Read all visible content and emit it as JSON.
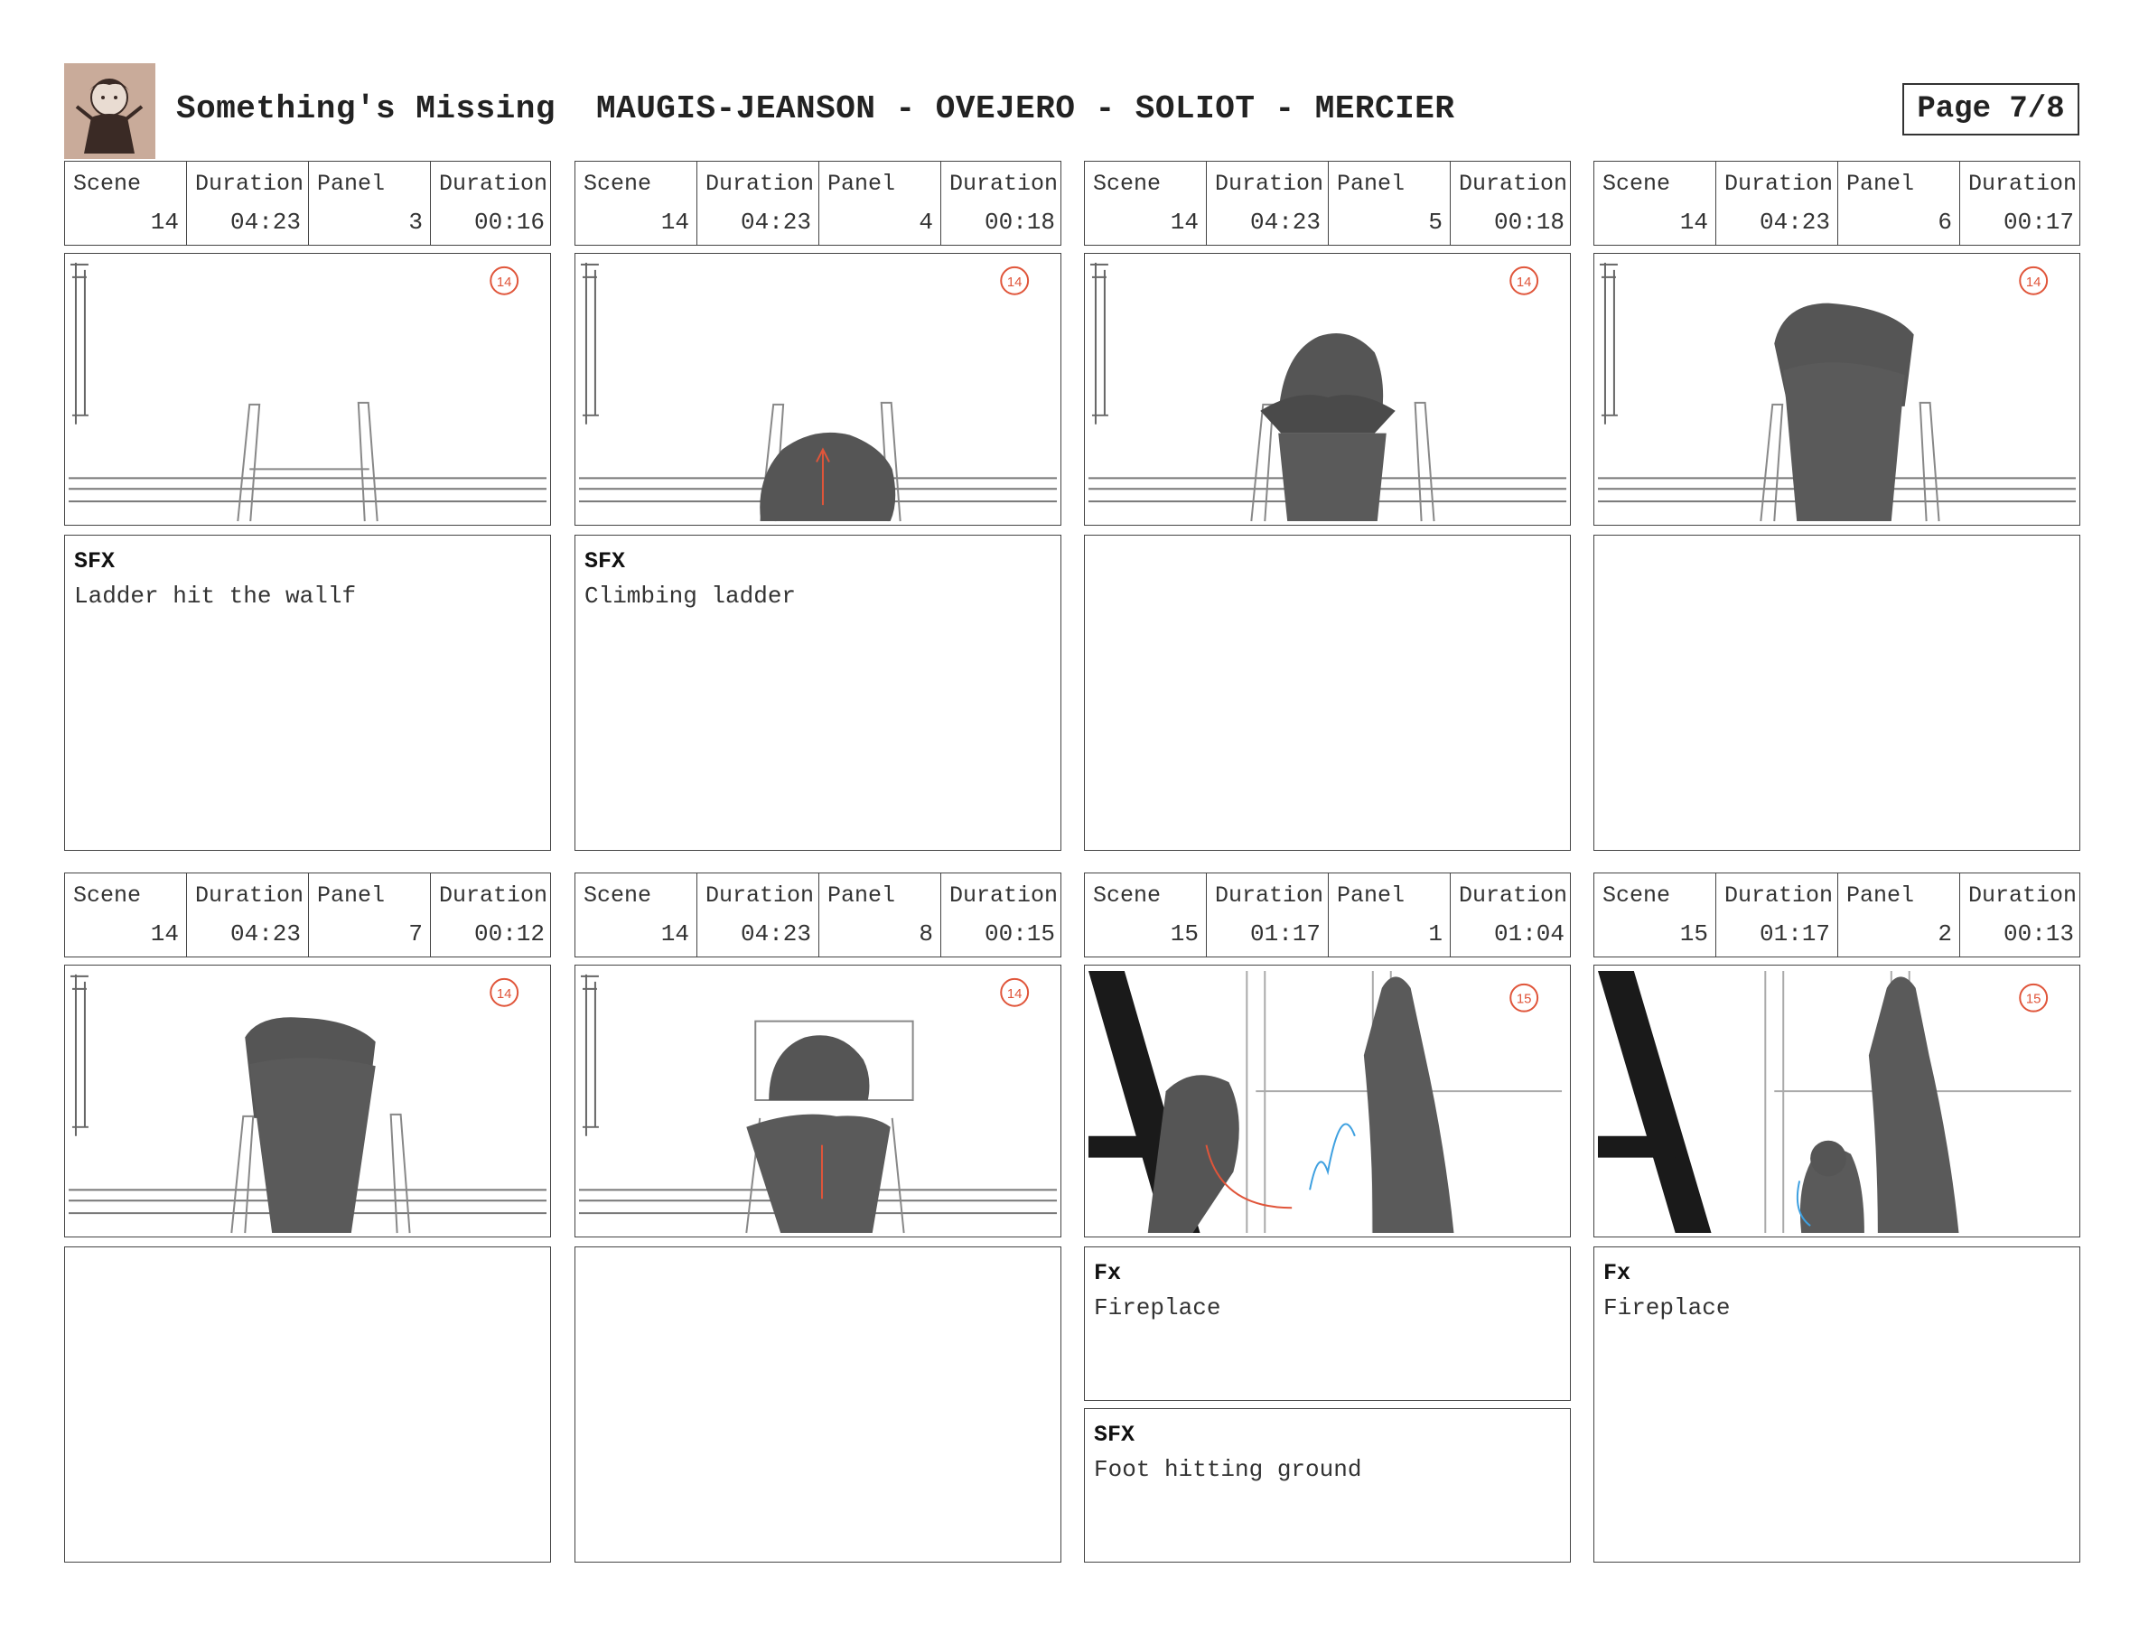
{
  "header": {
    "title": "Something's Missing",
    "authors": "MAUGIS-JEANSON - OVEJERO - SOLIOT - MERCIER",
    "page": "Page 7/8"
  },
  "labels": {
    "scene": "Scene",
    "duration": "Duration",
    "panel": "Panel"
  },
  "panels": [
    {
      "scene": "14",
      "scene_duration": "04:23",
      "panel": "3",
      "panel_duration": "00:16",
      "scene_badge": "14",
      "notes": [
        {
          "head": "SFX",
          "body": "Ladder hit the wallf"
        }
      ]
    },
    {
      "scene": "14",
      "scene_duration": "04:23",
      "panel": "4",
      "panel_duration": "00:18",
      "scene_badge": "14",
      "notes": [
        {
          "head": "SFX",
          "body": "Climbing ladder"
        }
      ]
    },
    {
      "scene": "14",
      "scene_duration": "04:23",
      "panel": "5",
      "panel_duration": "00:18",
      "scene_badge": "14",
      "notes": []
    },
    {
      "scene": "14",
      "scene_duration": "04:23",
      "panel": "6",
      "panel_duration": "00:17",
      "scene_badge": "14",
      "notes": []
    },
    {
      "scene": "14",
      "scene_duration": "04:23",
      "panel": "7",
      "panel_duration": "00:12",
      "scene_badge": "14",
      "notes": []
    },
    {
      "scene": "14",
      "scene_duration": "04:23",
      "panel": "8",
      "panel_duration": "00:15",
      "scene_badge": "14",
      "notes": []
    },
    {
      "scene": "15",
      "scene_duration": "01:17",
      "panel": "1",
      "panel_duration": "01:04",
      "scene_badge": "15",
      "notes": [
        {
          "head": "Fx",
          "body": "Fireplace"
        },
        {
          "head": "SFX",
          "body": "Foot hitting ground"
        }
      ]
    },
    {
      "scene": "15",
      "scene_duration": "01:17",
      "panel": "2",
      "panel_duration": "00:13",
      "scene_badge": "15",
      "notes": [
        {
          "head": "Fx",
          "body": "Fireplace"
        }
      ]
    }
  ]
}
